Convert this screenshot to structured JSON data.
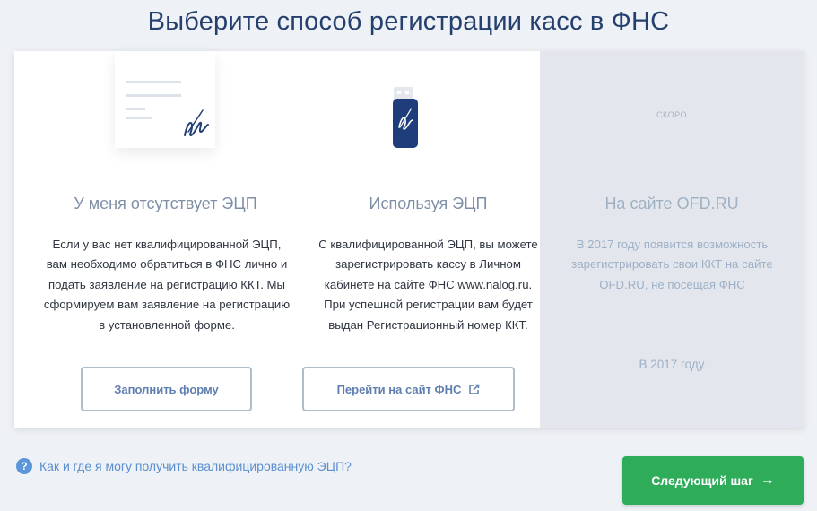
{
  "header": {
    "title": "Выберите способ регистрации касс в ФНС"
  },
  "cards": [
    {
      "title": "У меня отсутствует ЭЦП",
      "text": "Если у вас нет квалифицированной ЭЦП, вам необходимо обратиться в ФНС лично и подать заявление на регистрацию ККТ. Мы сформируем вам заявление на регистрацию в установленной форме.",
      "button": "Заполнить форму",
      "illustration": "signed-document-icon"
    },
    {
      "title": "Используя ЭЦП",
      "text": "С квалифицированной ЭЦП, вы можете зарегистрировать кассу в Личном кабинете на сайте ФНС www.nalog.ru. При успешной регистрации вам будет выдан Регистрационный номер ККТ.",
      "button": "Перейти на сайт ФНС",
      "button_icon": "external-link-icon",
      "illustration": "usb-token-icon"
    },
    {
      "badge": "СКОРО",
      "title": "На сайте OFD.RU",
      "text": "В 2017 году появится возможность зарегистрировать свои ККТ на сайте OFD.RU, не посещая ФНС",
      "footer": "В 2017 году"
    }
  ],
  "footer": {
    "help_icon": "?",
    "help_text": "Как и где я могу получить квалифицированную ЭЦП?",
    "next_button": "Следующий шаг",
    "next_arrow": "→"
  },
  "colors": {
    "title": "#25406e",
    "accent_green": "#2fac59",
    "link": "#5b8fd0",
    "usb_blue": "#1f3c7b"
  }
}
